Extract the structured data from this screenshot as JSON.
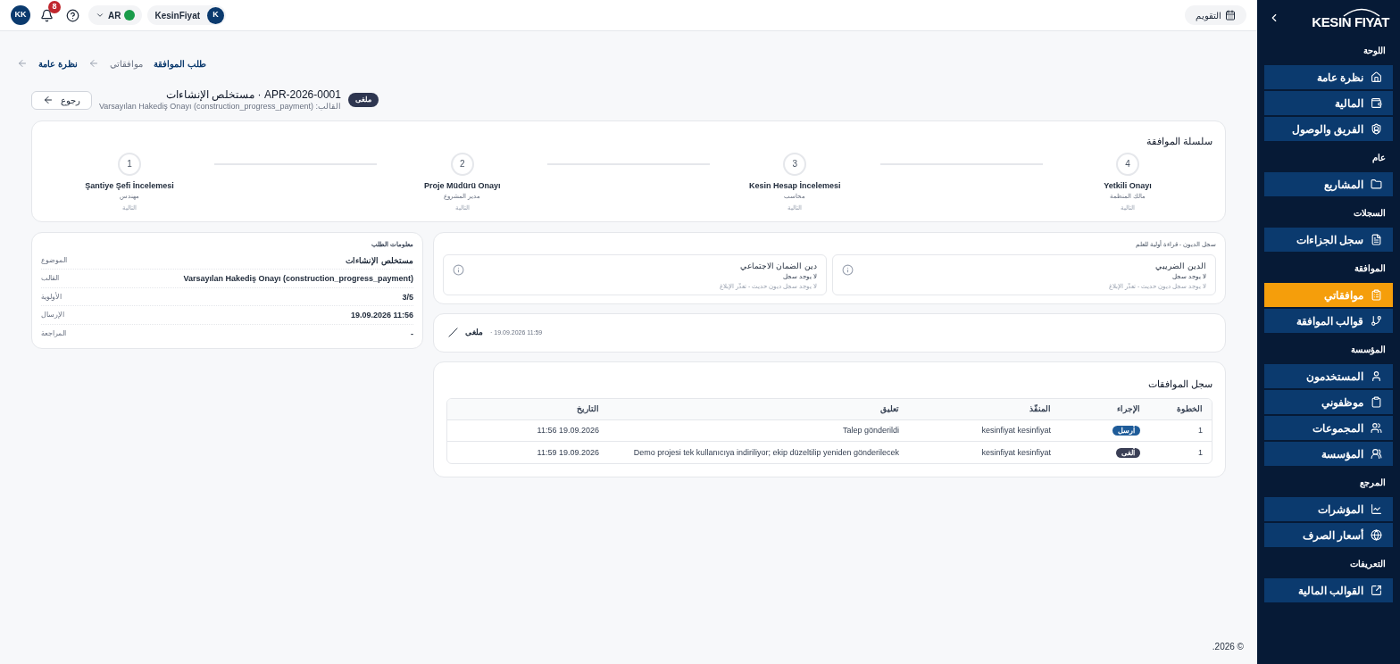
{
  "header": {
    "user_initials": "KK",
    "notification_count": "8",
    "language": "AR",
    "org_name": "KesinFiyat",
    "org_initial": "K",
    "calendar_label": "التقويم"
  },
  "breadcrumb": [
    {
      "label": "طلب الموافقة",
      "link": true
    },
    {
      "label": "موافقاتي",
      "link": false
    },
    {
      "label": "نظرة عامة",
      "link": true
    }
  ],
  "page": {
    "back_label": "رجوع",
    "status_badge": "ملغى",
    "title": "مستخلص الإنشاءات · APR-2026-0001",
    "subtitle": "القالب: Varsayılan Hakediş Onayı (construction_progress_payment)"
  },
  "chain": {
    "title": "سلسلة الموافقة",
    "steps": [
      {
        "number": "4",
        "name": "Yetkili Onayı",
        "role": "مالك المنظمة",
        "status": "التالية"
      },
      {
        "number": "3",
        "name": "Kesin Hesap İncelemesi",
        "role": "محاسب",
        "status": "التالية"
      },
      {
        "number": "2",
        "name": "Proje Müdürü Onayı",
        "role": "مدير المشروع",
        "status": "التالية"
      },
      {
        "number": "1",
        "name": "Şantiye Şefi İncelemesi",
        "role": "مهندس",
        "status": "التالية"
      }
    ]
  },
  "info": {
    "title": "معلومات الطلب",
    "rows": [
      {
        "label": "الموضوع",
        "value": "مستخلص الإنشاءات"
      },
      {
        "label": "القالب",
        "value": "Varsayılan Hakediş Onayı (construction_progress_payment)"
      },
      {
        "label": "الأولوية",
        "value": "3/5"
      },
      {
        "label": "الإرسال",
        "value": "19.09.2026 11:56"
      },
      {
        "label": "المراجعة",
        "value": "-"
      }
    ]
  },
  "debts": {
    "title": "سجل الديون - قراءة أولية للعلم",
    "items": [
      {
        "title": "الدين الضريبي",
        "status": "لا يوجد سجل",
        "note": "لا يوجد سجل ديون حديث - تعذّر الإبلاغ"
      },
      {
        "title": "دين الضمان الاجتماعي",
        "status": "لا يوجد سجل",
        "note": "لا يوجد سجل ديون حديث - تعذّر الإبلاغ"
      }
    ]
  },
  "activity": {
    "status": "ملغى",
    "time": "· 19.09.2026 11:59"
  },
  "log": {
    "title": "سجل الموافقات",
    "columns": [
      "الخطوة",
      "الإجراء",
      "المنفّذ",
      "تعليق",
      "التاريخ"
    ],
    "rows": [
      {
        "step": "1",
        "action": "أرسل",
        "color": "#1f5c99",
        "actor": "kesinfiyat kesinfiyat",
        "comment": "Talep gönderildi",
        "date": "19.09.2026 11:56"
      },
      {
        "step": "1",
        "action": "ألغى",
        "color": "#3a3f55",
        "actor": "kesinfiyat kesinfiyat",
        "comment": "Demo projesi tek kullanıcıya indiriliyor; ekip düzeltilip yeniden gönderilecek",
        "date": "19.09.2026 11:59"
      }
    ]
  },
  "footer": "© 2026.",
  "sidebar": {
    "logo": "KESIN FIYAT",
    "sections": [
      {
        "label": "اللوحة",
        "items": [
          {
            "label": "نظرة عامة",
            "selected": false
          },
          {
            "label": "المالية",
            "selected": false
          },
          {
            "label": "الفريق والوصول",
            "selected": false
          }
        ]
      },
      {
        "label": "عام",
        "items": [
          {
            "label": "المشاريع",
            "selected": false
          }
        ]
      },
      {
        "label": "السجلات",
        "items": [
          {
            "label": "سجل الجزاءات",
            "selected": false
          }
        ]
      },
      {
        "label": "الموافقة",
        "items": [
          {
            "label": "موافقاتي",
            "selected": true
          },
          {
            "label": "قوالب الموافقة",
            "selected": false
          }
        ]
      },
      {
        "label": "المؤسسة",
        "items": [
          {
            "label": "المستخدمون",
            "selected": false
          },
          {
            "label": "موظفوني",
            "selected": false
          },
          {
            "label": "المجموعات",
            "selected": false
          },
          {
            "label": "المؤسسة",
            "selected": false
          }
        ]
      },
      {
        "label": "المرجع",
        "items": [
          {
            "label": "المؤشرات",
            "selected": false
          },
          {
            "label": "أسعار الصرف",
            "selected": false
          }
        ]
      },
      {
        "label": "التعريفات",
        "items": [
          {
            "label": "القوالب المالية",
            "selected": false
          }
        ]
      }
    ]
  }
}
